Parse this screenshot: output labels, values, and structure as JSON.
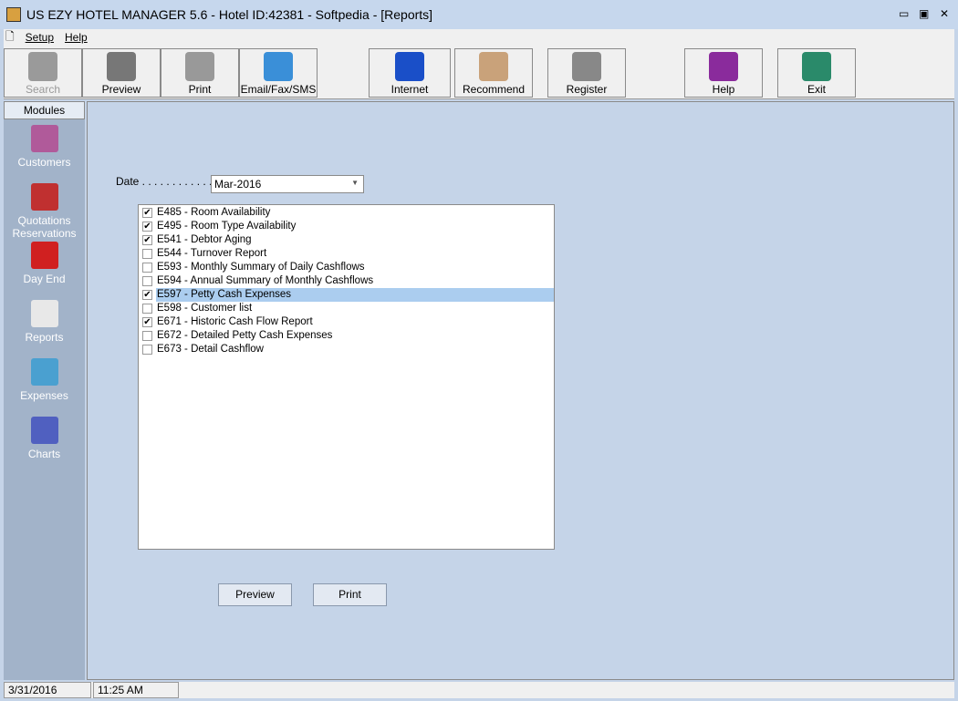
{
  "window": {
    "title": "US EZY HOTEL MANAGER 5.6 - Hotel ID:42381 - Softpedia - [Reports]"
  },
  "menu": [
    "Setup",
    "Help"
  ],
  "toolbar": [
    {
      "label": "Search",
      "icon": "binoculars-icon",
      "disabled": true,
      "color": "#9a9a9a"
    },
    {
      "label": "Preview",
      "icon": "preview-icon",
      "color": "#777"
    },
    {
      "label": "Print",
      "icon": "printer-icon",
      "color": "#999"
    },
    {
      "label": "Email/Fax/SMS",
      "icon": "envelope-icon",
      "color": "#3a8fd8"
    },
    {
      "label": "Internet",
      "icon": "globe-icon",
      "color": "#1a4fc8"
    },
    {
      "label": "Recommend",
      "icon": "handshake-icon",
      "color": "#c9a27a"
    },
    {
      "label": "Register",
      "icon": "keys-icon",
      "color": "#888"
    },
    {
      "label": "Help",
      "icon": "help-book-icon",
      "color": "#8a2b9c"
    },
    {
      "label": "Exit",
      "icon": "exit-door-icon",
      "color": "#2a8a6a"
    }
  ],
  "sidebar": {
    "header": "Modules",
    "items": [
      {
        "label": "Customers",
        "icon": "customers-icon",
        "color": "#b05a9a"
      },
      {
        "label": "Quotations Reservations",
        "icon": "reservations-icon",
        "color": "#c03030"
      },
      {
        "label": "Day End",
        "icon": "calendar-icon",
        "color": "#d02020"
      },
      {
        "label": "Reports",
        "icon": "reports-icon",
        "color": "#e8e8e8"
      },
      {
        "label": "Expenses",
        "icon": "expenses-icon",
        "color": "#4aa0d0"
      },
      {
        "label": "Charts",
        "icon": "chart-icon",
        "color": "#5060c0"
      }
    ]
  },
  "form": {
    "date_label": "Date . . . . . . . . . . . . . .",
    "date_value": "Mar-2016",
    "reports": [
      {
        "label": "E485 - Room Availability",
        "checked": true
      },
      {
        "label": "E495 - Room Type Availability",
        "checked": true
      },
      {
        "label": "E541 - Debtor Aging",
        "checked": true
      },
      {
        "label": "E544 - Turnover Report",
        "checked": false
      },
      {
        "label": "E593 - Monthly Summary of Daily Cashflows",
        "checked": false
      },
      {
        "label": "E594 - Annual Summary of Monthly Cashflows",
        "checked": false
      },
      {
        "label": "E597 - Petty Cash Expenses",
        "checked": true,
        "selected": true
      },
      {
        "label": "E598 - Customer list",
        "checked": false
      },
      {
        "label": "E671 - Historic Cash Flow Report",
        "checked": true
      },
      {
        "label": "E672 - Detailed Petty Cash Expenses",
        "checked": false
      },
      {
        "label": "E673 - Detail Cashflow",
        "checked": false
      }
    ],
    "preview_label": "Preview",
    "print_label": "Print"
  },
  "status": {
    "date": "3/31/2016",
    "time": "11:25 AM"
  }
}
